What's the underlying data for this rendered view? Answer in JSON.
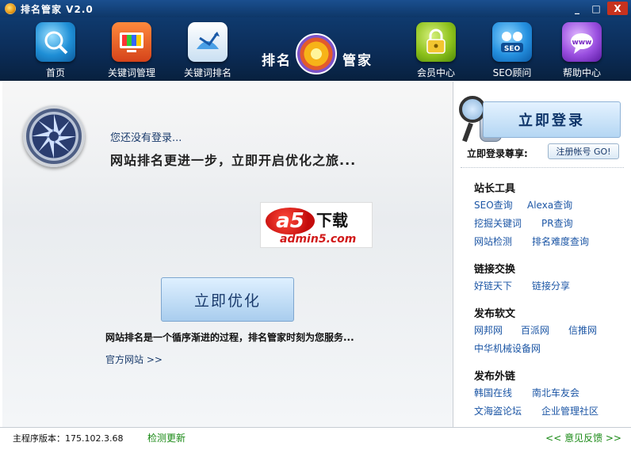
{
  "window": {
    "title": "排名管家 V2.0",
    "controls": {
      "minimize": "_",
      "maximize": "□",
      "close": "X"
    }
  },
  "toolbar": {
    "items": [
      {
        "label": "首页",
        "icon": "globe-search-icon"
      },
      {
        "label": "关键词管理",
        "icon": "tv-icon"
      },
      {
        "label": "关键词排名",
        "icon": "chart-bird-icon"
      },
      {
        "label": "会员中心",
        "icon": "padlock-icon"
      },
      {
        "label": "SEO顾问",
        "icon": "seo-people-icon"
      },
      {
        "label": "帮助中心",
        "icon": "www-icon"
      }
    ],
    "logo": {
      "left": "排名",
      "right": "管家"
    }
  },
  "main": {
    "not_logged_in": "您还没有登录...",
    "slogan": "网站排名更进一步，立即开启优化之旅...",
    "a5": {
      "mark": "a5",
      "dl": "下载",
      "url": "admin5.com"
    },
    "optimize_button": "立即优化",
    "process_text": "网站排名是一个循序渐进的过程，排名管家时刻为您服务...",
    "official_site": "官方网站 >>"
  },
  "side": {
    "login_button": "立即登录",
    "login_now": "立即登录尊享:",
    "register_button": "注册帐号 GO!",
    "sections": [
      {
        "title": "站长工具",
        "links": [
          "SEO查询",
          "Alexa查询",
          "挖掘关键词",
          "PR查询",
          "网站检测",
          "排名难度查询"
        ]
      },
      {
        "title": "链接交换",
        "links": [
          "好链天下",
          "链接分享"
        ]
      },
      {
        "title": "发布软文",
        "links": [
          "网邦网",
          "百派网",
          "信推网",
          "中华机械设备网"
        ]
      },
      {
        "title": "发布外链",
        "links": [
          "韩国在线",
          "南北车友会",
          "文海盗论坛",
          "企业管理社区"
        ]
      }
    ]
  },
  "status": {
    "version": "主程序版本：175.102.3.68",
    "check_update": "检测更新",
    "feedback": "<< 意见反馈 >>"
  },
  "colors": {
    "toolbar_bg": "#0b2b55",
    "link": "#1c56a5",
    "status_green": "#1a8a16",
    "close_red": "#c7321e"
  }
}
